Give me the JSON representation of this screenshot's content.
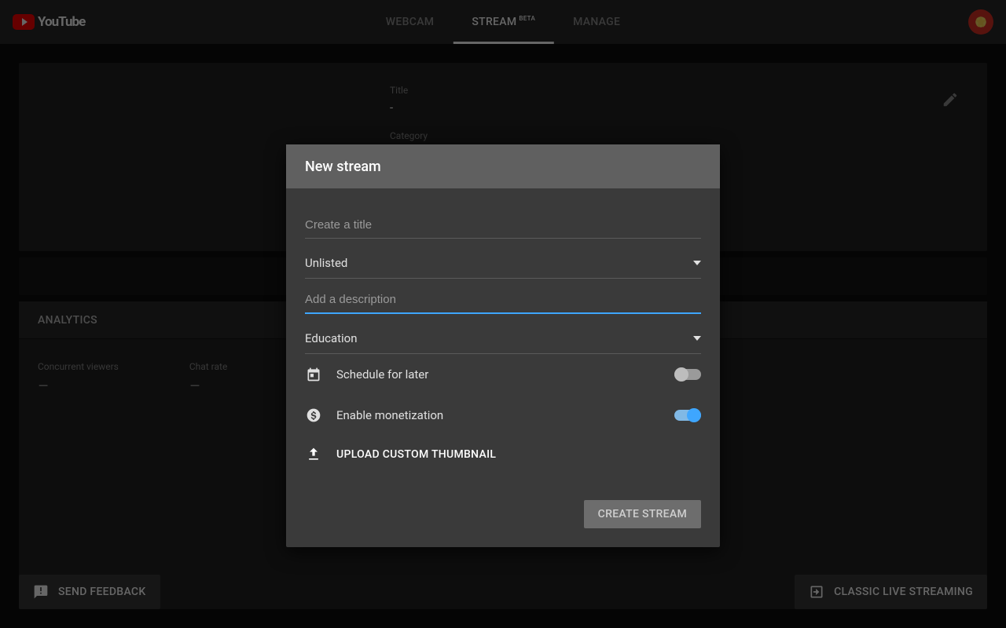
{
  "header": {
    "brand": "YouTube",
    "tabs": [
      {
        "label": "WEBCAM",
        "active": false
      },
      {
        "label": "STREAM",
        "active": true,
        "badge": "BETA"
      },
      {
        "label": "MANAGE",
        "active": false
      }
    ]
  },
  "preview": {
    "title_label": "Title",
    "title_value": "-",
    "category_label": "Category"
  },
  "analytics": {
    "header": "ANALYTICS",
    "metrics": [
      {
        "label": "Concurrent viewers",
        "value": "–"
      },
      {
        "label": "Chat rate",
        "value": "–"
      }
    ]
  },
  "buttons": {
    "feedback": "SEND FEEDBACK",
    "classic": "CLASSIC LIVE STREAMING"
  },
  "dialog": {
    "title": "New stream",
    "title_placeholder": "Create a title",
    "title_value": "",
    "privacy": "Unlisted",
    "description_placeholder": "Add a description",
    "description_value": "",
    "category": "Education",
    "schedule_label": "Schedule for later",
    "schedule_on": false,
    "monetization_label": "Enable monetization",
    "monetization_on": true,
    "upload_label": "UPLOAD CUSTOM THUMBNAIL",
    "submit_label": "CREATE STREAM"
  }
}
